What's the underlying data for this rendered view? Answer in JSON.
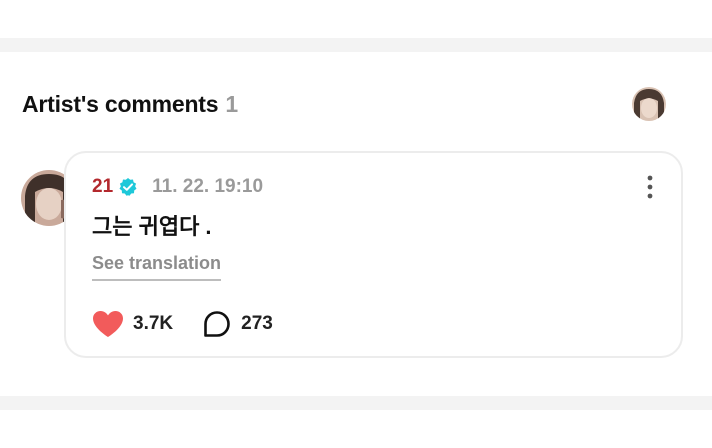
{
  "section": {
    "title": "Artist's comments",
    "count": "1"
  },
  "comment": {
    "author": "21",
    "verified": true,
    "timestamp": "11. 22. 19:10",
    "text": "그는 귀엽다 .",
    "translate_label": "See translation",
    "likes": "3.7K",
    "replies": "273"
  },
  "icons": {
    "verified": "verified-badge-icon",
    "more": "more-vertical-icon",
    "like": "heart-icon",
    "reply": "speech-bubble-icon"
  },
  "colors": {
    "author_name": "#b3282d",
    "verified_badge": "#1ec8d9",
    "like_heart": "#f25b5b",
    "muted_text": "#9a9a9a"
  }
}
